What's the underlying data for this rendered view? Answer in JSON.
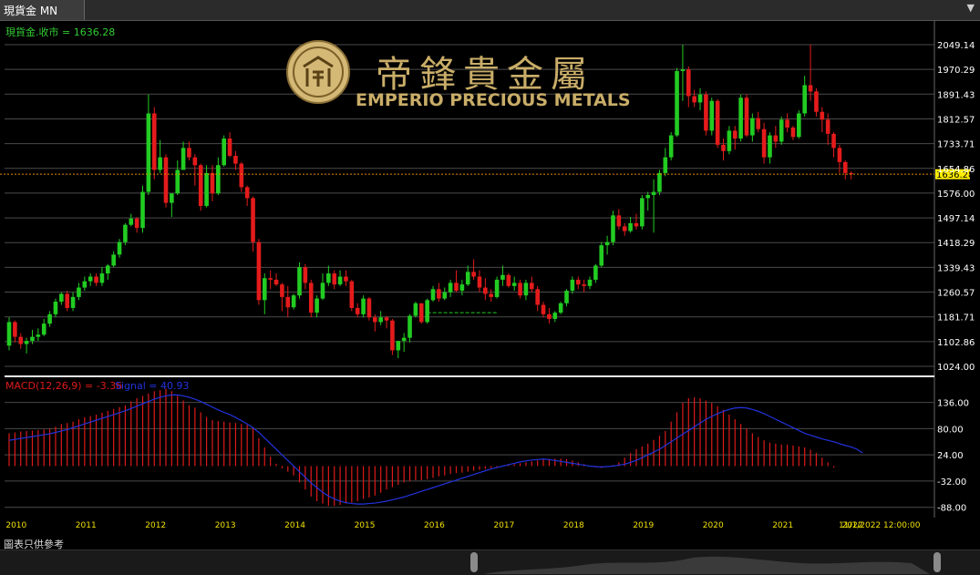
{
  "window": {
    "tab_title": "現貨金 MN",
    "menu_icon": "chevron-down-icon"
  },
  "brand": {
    "chinese_name": "帝鋒貴金屬",
    "english_name": "EMPERIO PRECIOUS METALS"
  },
  "price_panel": {
    "legend": "現貨金.收市 = 1636.28",
    "last_price": "1636.28"
  },
  "macd_panel": {
    "legend_macd": "MACD(12,26,9) = -3.36",
    "legend_signal": "Signal = 40.93"
  },
  "time_axis": {
    "cursor_label": "11/1/2022 12:00:00"
  },
  "footer": {
    "note": "圖表只供參考"
  },
  "colors": {
    "up": "#22cc22",
    "down": "#e41b1b",
    "grid": "#4a4a4a",
    "axis_text": "#ffffff",
    "year_text": "#f0e000",
    "last_line": "#e08a00",
    "last_tag": "#ffee00",
    "signal": "#2233dd",
    "macd_hist": "#dd1a1a",
    "brand_gold": "#c9ad68",
    "legend_green": "#33cc33"
  },
  "chart_data": [
    {
      "type": "candlestick",
      "title": "現貨金.收市 = 1636.28",
      "ylim": [
        1024.0,
        2049.14
      ],
      "y_ticks": [
        "2049.14",
        "1970.29",
        "1891.43",
        "1812.57",
        "1733.71",
        "1654.86",
        "1576.00",
        "1497.14",
        "1418.29",
        "1339.43",
        "1260.57",
        "1181.71",
        "1102.86",
        "1024.00"
      ],
      "x_ticks": [
        {
          "label": "2010",
          "i": 1
        },
        {
          "label": "2011",
          "i": 13
        },
        {
          "label": "2012",
          "i": 25
        },
        {
          "label": "2013",
          "i": 37
        },
        {
          "label": "2014",
          "i": 49
        },
        {
          "label": "2015",
          "i": 61
        },
        {
          "label": "2016",
          "i": 73
        },
        {
          "label": "2017",
          "i": 85
        },
        {
          "label": "2018",
          "i": 97
        },
        {
          "label": "2019",
          "i": 109
        },
        {
          "label": "2020",
          "i": 121
        },
        {
          "label": "2021",
          "i": 133
        },
        {
          "label": "2022",
          "i": 145
        }
      ],
      "last_value": 1636.28,
      "gap_line": {
        "from_i": 72,
        "to_i": 84,
        "value": 1195
      },
      "ohlc": [
        [
          1090,
          1180,
          1075,
          1165
        ],
        [
          1165,
          1170,
          1100,
          1118
        ],
        [
          1118,
          1130,
          1080,
          1095
        ],
        [
          1095,
          1115,
          1065,
          1105
        ],
        [
          1105,
          1140,
          1095,
          1118
        ],
        [
          1118,
          1145,
          1105,
          1125
        ],
        [
          1125,
          1175,
          1120,
          1160
        ],
        [
          1160,
          1200,
          1150,
          1190
        ],
        [
          1190,
          1240,
          1180,
          1230
        ],
        [
          1230,
          1260,
          1220,
          1255
        ],
        [
          1255,
          1265,
          1200,
          1210
        ],
        [
          1210,
          1260,
          1200,
          1245
        ],
        [
          1245,
          1290,
          1235,
          1275
        ],
        [
          1275,
          1310,
          1265,
          1295
        ],
        [
          1295,
          1320,
          1280,
          1310
        ],
        [
          1310,
          1320,
          1280,
          1290
        ],
        [
          1290,
          1340,
          1280,
          1320
        ],
        [
          1320,
          1350,
          1300,
          1345
        ],
        [
          1345,
          1390,
          1340,
          1380
        ],
        [
          1380,
          1430,
          1370,
          1420
        ],
        [
          1420,
          1480,
          1410,
          1475
        ],
        [
          1475,
          1510,
          1470,
          1495
        ],
        [
          1495,
          1500,
          1450,
          1465
        ],
        [
          1465,
          1600,
          1450,
          1580
        ],
        [
          1580,
          1890,
          1570,
          1830
        ],
        [
          1830,
          1850,
          1620,
          1650
        ],
        [
          1650,
          1745,
          1640,
          1690
        ],
        [
          1690,
          1700,
          1530,
          1545
        ],
        [
          1545,
          1555,
          1500,
          1575
        ],
        [
          1575,
          1680,
          1570,
          1650
        ],
        [
          1650,
          1740,
          1650,
          1720
        ],
        [
          1720,
          1740,
          1680,
          1690
        ],
        [
          1690,
          1700,
          1600,
          1665
        ],
        [
          1665,
          1670,
          1520,
          1535
        ],
        [
          1535,
          1665,
          1530,
          1640
        ],
        [
          1640,
          1665,
          1550,
          1575
        ],
        [
          1575,
          1690,
          1570,
          1665
        ],
        [
          1665,
          1760,
          1660,
          1750
        ],
        [
          1750,
          1770,
          1690,
          1695
        ],
        [
          1695,
          1710,
          1650,
          1670
        ],
        [
          1670,
          1675,
          1580,
          1595
        ],
        [
          1595,
          1600,
          1535,
          1560
        ],
        [
          1560,
          1565,
          1390,
          1420
        ],
        [
          1420,
          1430,
          1220,
          1235
        ],
        [
          1235,
          1320,
          1190,
          1305
        ],
        [
          1305,
          1330,
          1270,
          1300
        ],
        [
          1300,
          1320,
          1280,
          1285
        ],
        [
          1285,
          1290,
          1200,
          1245
        ],
        [
          1245,
          1280,
          1180,
          1212
        ],
        [
          1212,
          1255,
          1205,
          1250
        ],
        [
          1250,
          1355,
          1240,
          1340
        ],
        [
          1340,
          1350,
          1270,
          1290
        ],
        [
          1290,
          1300,
          1180,
          1195
        ],
        [
          1195,
          1250,
          1180,
          1240
        ],
        [
          1240,
          1320,
          1235,
          1290
        ],
        [
          1290,
          1345,
          1280,
          1320
        ],
        [
          1320,
          1330,
          1270,
          1285
        ],
        [
          1285,
          1330,
          1280,
          1310
        ],
        [
          1310,
          1330,
          1280,
          1295
        ],
        [
          1295,
          1300,
          1200,
          1210
        ],
        [
          1210,
          1225,
          1180,
          1190
        ],
        [
          1190,
          1250,
          1180,
          1240
        ],
        [
          1240,
          1245,
          1170,
          1180
        ],
        [
          1180,
          1190,
          1135,
          1165
        ],
        [
          1165,
          1200,
          1155,
          1180
        ],
        [
          1180,
          1185,
          1145,
          1170
        ],
        [
          1170,
          1175,
          1060,
          1075
        ],
        [
          1075,
          1090,
          1050,
          1105
        ],
        [
          1105,
          1130,
          1070,
          1115
        ],
        [
          1115,
          1190,
          1100,
          1185
        ],
        [
          1185,
          1230,
          1180,
          1225
        ],
        [
          1225,
          1225,
          1160,
          1165
        ],
        [
          1165,
          1240,
          1160,
          1235
        ],
        [
          1235,
          1280,
          1230,
          1270
        ],
        [
          1270,
          1290,
          1230,
          1240
        ],
        [
          1240,
          1275,
          1235,
          1260
        ],
        [
          1260,
          1300,
          1245,
          1290
        ],
        [
          1290,
          1330,
          1260,
          1265
        ],
        [
          1265,
          1300,
          1250,
          1285
        ],
        [
          1285,
          1345,
          1280,
          1325
        ],
        [
          1325,
          1365,
          1300,
          1310
        ],
        [
          1310,
          1330,
          1260,
          1275
        ],
        [
          1275,
          1305,
          1235,
          1255
        ],
        [
          1255,
          1270,
          1230,
          1245
        ],
        [
          1245,
          1310,
          1240,
          1300
        ],
        [
          1300,
          1345,
          1280,
          1315
        ],
        [
          1315,
          1320,
          1275,
          1280
        ],
        [
          1280,
          1310,
          1265,
          1290
        ],
        [
          1290,
          1300,
          1240,
          1250
        ],
        [
          1250,
          1300,
          1235,
          1290
        ],
        [
          1290,
          1310,
          1260,
          1270
        ],
        [
          1270,
          1280,
          1200,
          1220
        ],
        [
          1220,
          1230,
          1180,
          1190
        ],
        [
          1190,
          1210,
          1160,
          1175
        ],
        [
          1175,
          1200,
          1165,
          1195
        ],
        [
          1195,
          1230,
          1190,
          1225
        ],
        [
          1225,
          1270,
          1215,
          1265
        ],
        [
          1265,
          1310,
          1255,
          1300
        ],
        [
          1300,
          1310,
          1270,
          1285
        ],
        [
          1285,
          1300,
          1260,
          1280
        ],
        [
          1280,
          1310,
          1270,
          1300
        ],
        [
          1300,
          1350,
          1290,
          1345
        ],
        [
          1345,
          1420,
          1340,
          1410
        ],
        [
          1410,
          1440,
          1380,
          1420
        ],
        [
          1420,
          1520,
          1410,
          1505
        ],
        [
          1505,
          1525,
          1460,
          1470
        ],
        [
          1470,
          1480,
          1440,
          1455
        ],
        [
          1455,
          1500,
          1450,
          1480
        ],
        [
          1480,
          1510,
          1460,
          1470
        ],
        [
          1470,
          1570,
          1460,
          1560
        ],
        [
          1560,
          1580,
          1520,
          1570
        ],
        [
          1570,
          1620,
          1450,
          1580
        ],
        [
          1580,
          1650,
          1570,
          1640
        ],
        [
          1640,
          1720,
          1630,
          1690
        ],
        [
          1690,
          1770,
          1680,
          1760
        ],
        [
          1760,
          1975,
          1755,
          1965
        ],
        [
          1965,
          2049,
          1870,
          1970
        ],
        [
          1970,
          1980,
          1850,
          1885
        ],
        [
          1885,
          1905,
          1850,
          1865
        ],
        [
          1865,
          1910,
          1840,
          1890
        ],
        [
          1890,
          1900,
          1760,
          1775
        ],
        [
          1775,
          1880,
          1760,
          1870
        ],
        [
          1870,
          1875,
          1720,
          1730
        ],
        [
          1730,
          1750,
          1680,
          1710
        ],
        [
          1710,
          1790,
          1700,
          1775
        ],
        [
          1775,
          1790,
          1715,
          1750
        ],
        [
          1750,
          1890,
          1740,
          1880
        ],
        [
          1880,
          1890,
          1755,
          1760
        ],
        [
          1760,
          1830,
          1740,
          1815
        ],
        [
          1815,
          1835,
          1770,
          1780
        ],
        [
          1780,
          1800,
          1670,
          1690
        ],
        [
          1690,
          1770,
          1670,
          1760
        ],
        [
          1760,
          1790,
          1720,
          1740
        ],
        [
          1740,
          1820,
          1730,
          1810
        ],
        [
          1810,
          1830,
          1770,
          1785
        ],
        [
          1785,
          1790,
          1745,
          1755
        ],
        [
          1755,
          1840,
          1750,
          1830
        ],
        [
          1830,
          1950,
          1820,
          1920
        ],
        [
          1920,
          2049,
          1870,
          1900
        ],
        [
          1900,
          1910,
          1820,
          1835
        ],
        [
          1835,
          1850,
          1770,
          1810
        ],
        [
          1810,
          1830,
          1730,
          1765
        ],
        [
          1765,
          1770,
          1690,
          1720
        ],
        [
          1720,
          1730,
          1640,
          1675
        ],
        [
          1675,
          1680,
          1620,
          1640
        ],
        [
          1640,
          1645,
          1620,
          1636.28
        ]
      ]
    },
    {
      "type": "bar_line",
      "title": "MACD(12,26,9) = -3.36  Signal = 40.93",
      "ylim": [
        -110,
        180
      ],
      "y_ticks": [
        "136.00",
        "80.00",
        "24.00",
        "-32.00",
        "-88.00"
      ],
      "macd_values": [
        70,
        72,
        74,
        75,
        76,
        77,
        78,
        80,
        84,
        90,
        92,
        95,
        100,
        104,
        107,
        110,
        114,
        118,
        122,
        126,
        130,
        138,
        145,
        150,
        155,
        160,
        162,
        165,
        160,
        150,
        140,
        130,
        125,
        115,
        105,
        98,
        96,
        95,
        93,
        92,
        90,
        88,
        80,
        60,
        40,
        20,
        5,
        -5,
        -12,
        -20,
        -35,
        -50,
        -65,
        -75,
        -80,
        -85,
        -85,
        -83,
        -80,
        -78,
        -75,
        -70,
        -67,
        -63,
        -57,
        -50,
        -45,
        -40,
        -35,
        -32,
        -30,
        -30,
        -28,
        -25,
        -22,
        -20,
        -17,
        -15,
        -14,
        -12,
        -10,
        -8,
        -6,
        -4,
        -2,
        0,
        2,
        4,
        6,
        8,
        10,
        12,
        14,
        15,
        16,
        16,
        15,
        12,
        8,
        4,
        0,
        -3,
        -4,
        -2,
        2,
        8,
        18,
        28,
        36,
        42,
        48,
        56,
        65,
        75,
        95,
        115,
        135,
        145,
        147,
        145,
        140,
        135,
        128,
        120,
        110,
        100,
        90,
        80,
        70,
        62,
        55,
        50,
        48,
        46,
        46,
        44,
        42,
        40,
        35,
        28,
        18,
        8,
        -3.36
      ],
      "signal_values": [
        55,
        57,
        59,
        61,
        63,
        65,
        67,
        69,
        72,
        75,
        78,
        82,
        86,
        90,
        94,
        98,
        102,
        106,
        110,
        114,
        118,
        123,
        128,
        133,
        138,
        143,
        147,
        150,
        152,
        152,
        150,
        147,
        143,
        138,
        132,
        126,
        120,
        115,
        110,
        104,
        97,
        90,
        82,
        72,
        60,
        48,
        36,
        24,
        12,
        0,
        -12,
        -24,
        -36,
        -46,
        -56,
        -64,
        -70,
        -75,
        -78,
        -80,
        -81,
        -81,
        -80,
        -79,
        -77,
        -75,
        -72,
        -69,
        -66,
        -62,
        -58,
        -54,
        -50,
        -46,
        -42,
        -38,
        -34,
        -30,
        -26,
        -22,
        -18,
        -14,
        -10,
        -6,
        -3,
        0,
        3,
        6,
        9,
        11,
        13,
        14,
        15,
        14,
        12,
        10,
        8,
        6,
        4,
        2,
        0,
        -1,
        -2,
        -1,
        0,
        2,
        4,
        8,
        12,
        18,
        24,
        30,
        36,
        44,
        52,
        60,
        68,
        76,
        84,
        92,
        100,
        106,
        112,
        117,
        121,
        124,
        125,
        124,
        121,
        117,
        112,
        106,
        100,
        94,
        88,
        82,
        76,
        70,
        66,
        62,
        58,
        55,
        52,
        48,
        44,
        41,
        36,
        28
      ]
    }
  ]
}
